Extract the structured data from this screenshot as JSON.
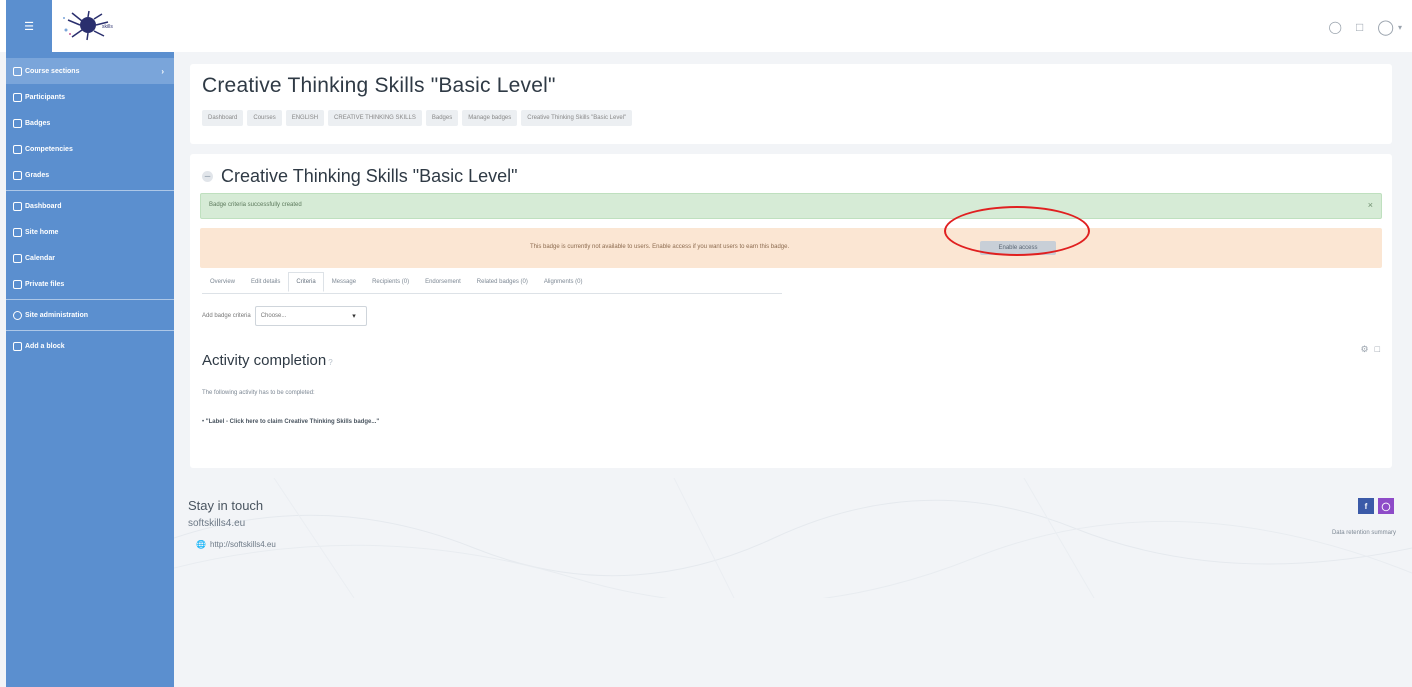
{
  "navbar": {
    "menu_icon": "hamburger-icon",
    "logo_alt": "soft skills logo",
    "icons": [
      "chat-icon",
      "bell-icon",
      "user-avatar-icon",
      "chevron-down-icon"
    ]
  },
  "sidebar": {
    "items": [
      {
        "label": "Course sections",
        "icon": "folder-icon",
        "has_arrow": true
      },
      {
        "label": "Participants",
        "icon": "users-icon"
      },
      {
        "label": "Badges",
        "icon": "badge-icon"
      },
      {
        "label": "Competencies",
        "icon": "check-icon"
      },
      {
        "label": "Grades",
        "icon": "table-icon"
      },
      {
        "label": "Dashboard",
        "icon": "dashboard-icon"
      },
      {
        "label": "Site home",
        "icon": "home-icon"
      },
      {
        "label": "Calendar",
        "icon": "calendar-icon"
      },
      {
        "label": "Private files",
        "icon": "file-icon"
      },
      {
        "label": "Site administration",
        "icon": "gear-icon"
      },
      {
        "label": "Add a block",
        "icon": "plus-icon"
      }
    ]
  },
  "header": {
    "title": "Creative Thinking Skills \"Basic Level\"",
    "breadcrumb": [
      "Dashboard",
      "Courses",
      "ENGLISH",
      "CREATIVE THINKING SKILLS",
      "Badges",
      "Manage badges",
      "Creative Thinking Skills \"Basic Level\""
    ]
  },
  "badge": {
    "heading": "Creative Thinking Skills \"Basic Level\"",
    "success_message": "Badge criteria successfully created",
    "warning_message": "This badge is currently not available to users. Enable access if you want users to earn this badge.",
    "enable_button": "Enable access",
    "tabs": [
      {
        "label": "Overview",
        "active": false
      },
      {
        "label": "Edit details",
        "active": false
      },
      {
        "label": "Criteria",
        "active": true
      },
      {
        "label": "Message",
        "active": false
      },
      {
        "label": "Recipients (0)",
        "active": false
      },
      {
        "label": "Endorsement",
        "active": false
      },
      {
        "label": "Related badges (0)",
        "active": false
      },
      {
        "label": "Alignments (0)",
        "active": false
      }
    ],
    "add_criteria_label": "Add badge criteria",
    "add_criteria_value": "Choose..."
  },
  "activity": {
    "heading": "Activity completion",
    "description": "The following activity has to be completed:",
    "item": "\"Label - Click here to claim Creative Thinking Skills badge...\""
  },
  "footer": {
    "stay_title": "Stay in touch",
    "site_name": "softskills4.eu",
    "site_url": "http://softskills4.eu",
    "retention": "Data retention summary",
    "social": [
      "f",
      "ig"
    ]
  },
  "colors": {
    "sidebar": "#5b8fcf",
    "success_bg": "#d6ebd6",
    "warning_bg": "#fbe6d3",
    "annotation": "#e02020"
  }
}
